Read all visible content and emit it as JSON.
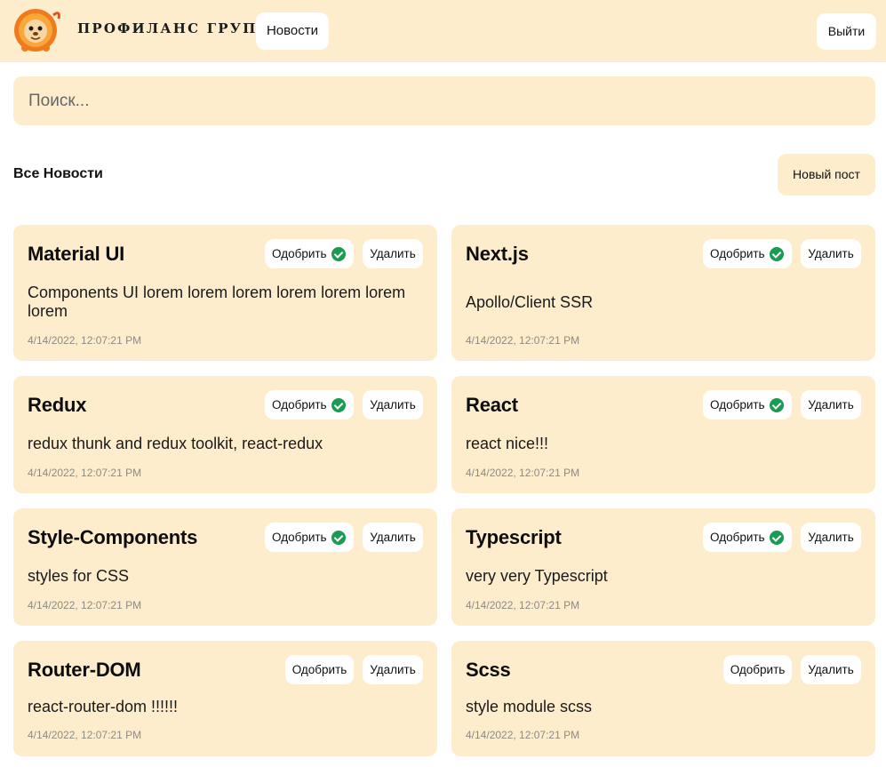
{
  "header": {
    "brand": "ПРОФИЛАНС ГРУПП",
    "nav_news": "Новости",
    "logout": "Выйти"
  },
  "search": {
    "placeholder": "Поиск..."
  },
  "section": {
    "title": "Все Новости",
    "new_post": "Новый пост"
  },
  "labels": {
    "approve": "Одобрить",
    "delete": "Удалить"
  },
  "posts": [
    {
      "title": "Material UI",
      "body": "Components UI lorem lorem lorem lorem lorem lorem lorem",
      "date": "4/14/2022, 12:07:21 PM",
      "approved": true
    },
    {
      "title": "Next.js",
      "body": "Apollo/Client SSR",
      "date": "4/14/2022, 12:07:21 PM",
      "approved": true
    },
    {
      "title": "Redux",
      "body": "redux thunk and redux toolkit, react-redux",
      "date": "4/14/2022, 12:07:21 PM",
      "approved": true
    },
    {
      "title": "React",
      "body": "react nice!!!",
      "date": "4/14/2022, 12:07:21 PM",
      "approved": true
    },
    {
      "title": "Style-Components",
      "body": "styles for CSS",
      "date": "4/14/2022, 12:07:21 PM",
      "approved": true
    },
    {
      "title": "Typescript",
      "body": "very very Typescript",
      "date": "4/14/2022, 12:07:21 PM",
      "approved": true
    },
    {
      "title": "Router-DOM",
      "body": "react-router-dom !!!!!!",
      "date": "4/14/2022, 12:07:21 PM",
      "approved": false
    },
    {
      "title": "Scss",
      "body": "style module scss",
      "date": "4/14/2022, 12:07:21 PM",
      "approved": false
    }
  ],
  "colors": {
    "accent_bg": "#feedcd",
    "approved_check": "#1a9b52"
  }
}
